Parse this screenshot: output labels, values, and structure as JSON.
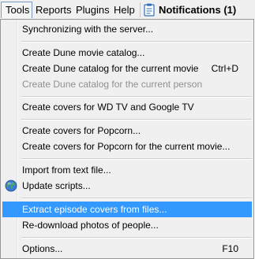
{
  "menubar": {
    "tools": "Tools",
    "reports": "Reports",
    "plugins": "Plugins",
    "help": "Help",
    "notifications": "Notifications (1)"
  },
  "menu": {
    "items": [
      {
        "label": "Synchronizing with the server...",
        "shortcut": "",
        "enabled": true
      },
      {
        "label": "Create Dune movie catalog...",
        "shortcut": "",
        "enabled": true
      },
      {
        "label": "Create Dune catalog for the current movie",
        "shortcut": "Ctrl+D",
        "enabled": true
      },
      {
        "label": "Create Dune catalog for the current person",
        "shortcut": "",
        "enabled": false
      },
      {
        "label": "Create covers for WD TV and Google TV",
        "shortcut": "",
        "enabled": true
      },
      {
        "label": "Create covers for Popcorn...",
        "shortcut": "",
        "enabled": true
      },
      {
        "label": "Create covers for Popcorn for the current movie...",
        "shortcut": "",
        "enabled": true
      },
      {
        "label": "Import from text file...",
        "shortcut": "",
        "enabled": true
      },
      {
        "label": "Update scripts...",
        "shortcut": "",
        "enabled": true,
        "icon": "globe-icon"
      },
      {
        "label": "Extract episode covers from files...",
        "shortcut": "",
        "enabled": true,
        "selected": true
      },
      {
        "label": "Re-download photos of people...",
        "shortcut": "",
        "enabled": true
      },
      {
        "label": "Options...",
        "shortcut": "F10",
        "enabled": true
      }
    ]
  },
  "colors": {
    "highlight": "#3399ff",
    "menu_bg": "#f0f0f0",
    "disabled_text": "#8f8f8f"
  }
}
